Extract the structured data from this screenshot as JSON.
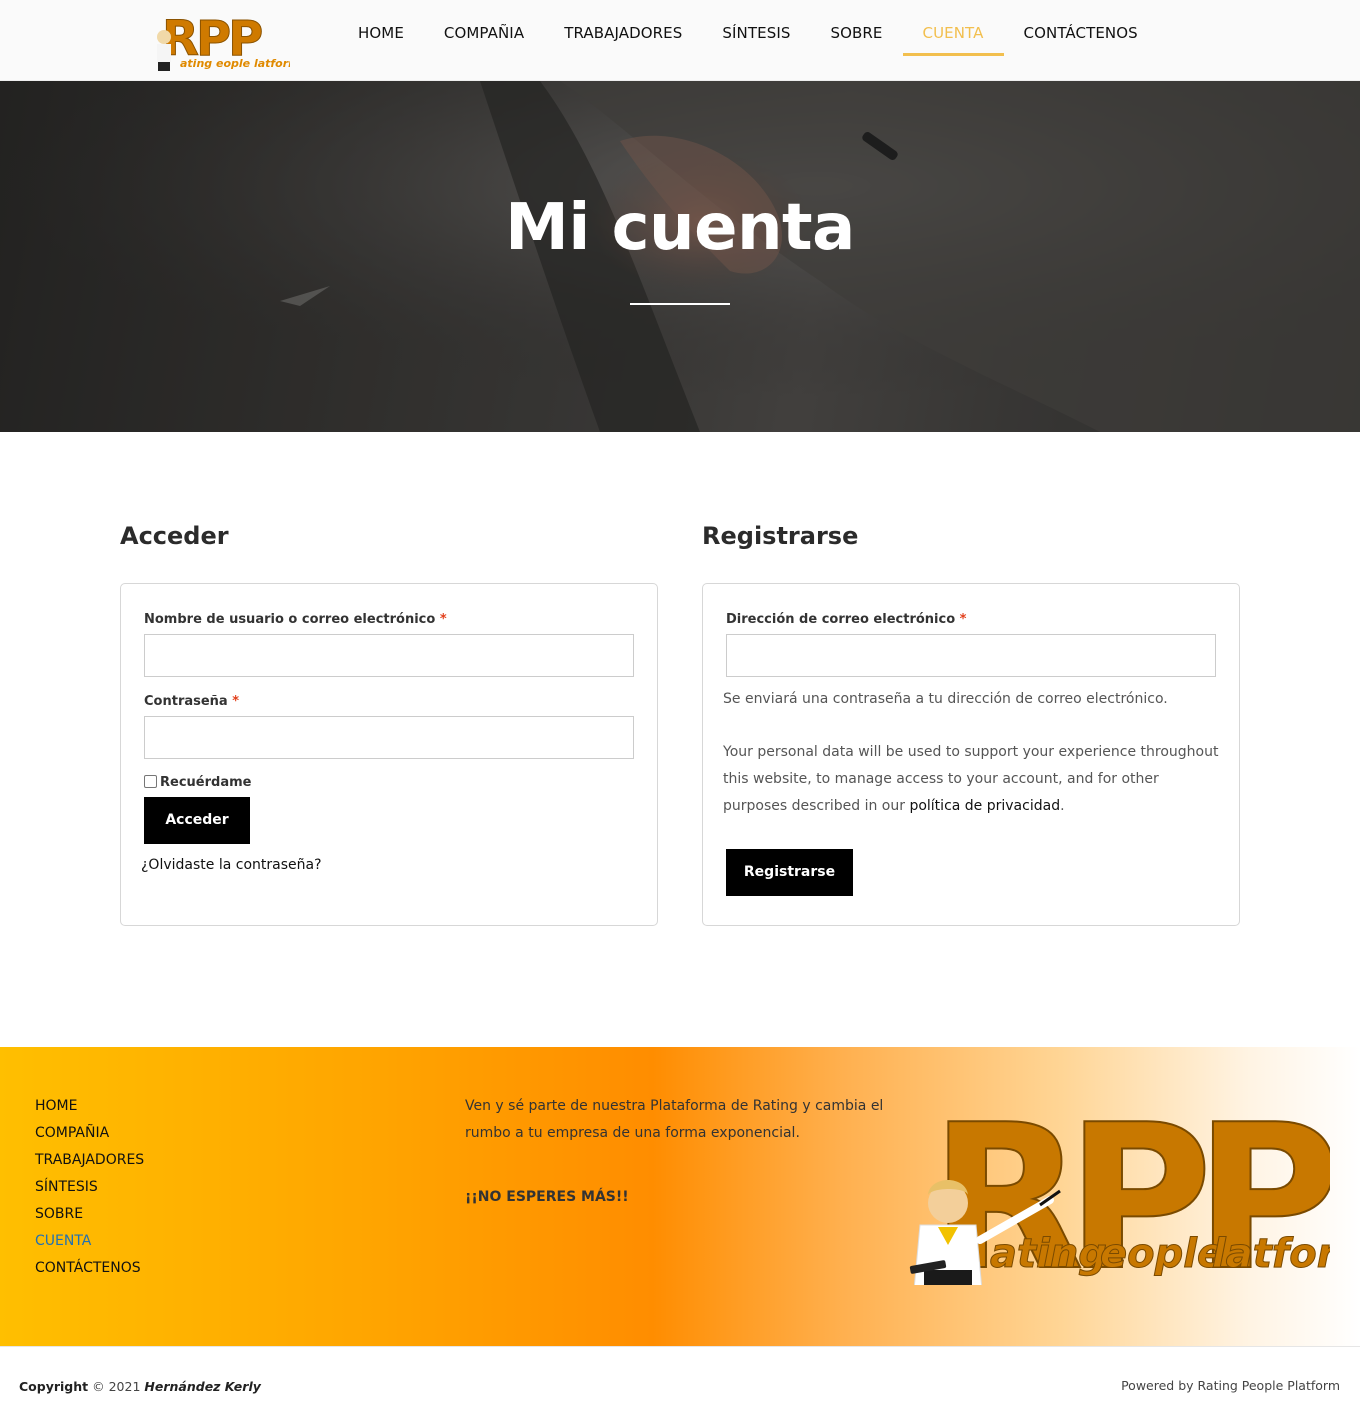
{
  "header": {
    "logo_alt": "RPP Rating People Platform",
    "nav": [
      {
        "label": "HOME"
      },
      {
        "label": "COMPAÑIA"
      },
      {
        "label": "TRABAJADORES"
      },
      {
        "label": "SÍNTESIS"
      },
      {
        "label": "SOBRE"
      },
      {
        "label": "CUENTA",
        "active": true
      },
      {
        "label": "CONTÁCTENOS"
      }
    ],
    "accent_color": "#f2bf4e"
  },
  "hero": {
    "title": "Mi cuenta"
  },
  "login": {
    "title": "Acceder",
    "username_label": "Nombre de usuario o correo electrónico",
    "username_value": "",
    "password_label": "Contraseña",
    "password_value": "",
    "required_mark": "*",
    "remember_label": "Recuérdame",
    "remember_checked": false,
    "submit_label": "Acceder",
    "lost_password": "¿Olvidaste la contraseña?"
  },
  "register": {
    "title": "Registrarse",
    "email_label": "Dirección de correo electrónico",
    "email_value": "",
    "required_mark": "*",
    "password_note": "Se enviará una contraseña a tu dirección de correo electrónico.",
    "privacy_text": "Your personal data will be used to support your experience throughout this website, to manage access to your account, and for other purposes described in our",
    "privacy_link": "política de privacidad",
    "privacy_end": ".",
    "submit_label": "Registrarse"
  },
  "footer": {
    "menu": [
      {
        "label": "HOME"
      },
      {
        "label": "COMPAÑIA"
      },
      {
        "label": "TRABAJADORES"
      },
      {
        "label": "SÍNTESIS"
      },
      {
        "label": "SOBRE"
      },
      {
        "label": "CUENTA",
        "active": true
      },
      {
        "label": "CONTÁCTENOS"
      }
    ],
    "text": "Ven y sé parte de nuestra Plataforma de Rating y cambia el rumbo a tu empresa de una forma exponencial.",
    "cta": "¡¡NO ESPERES MÁS!!",
    "logo_letters": "RPP",
    "logo_words": [
      "ating",
      "eople",
      "latform"
    ]
  },
  "bottom": {
    "copyright_label": "Copyright",
    "copyright_year": "© 2021",
    "author": "Hernández Kerly",
    "powered": "Powered by Rating People Platform"
  }
}
